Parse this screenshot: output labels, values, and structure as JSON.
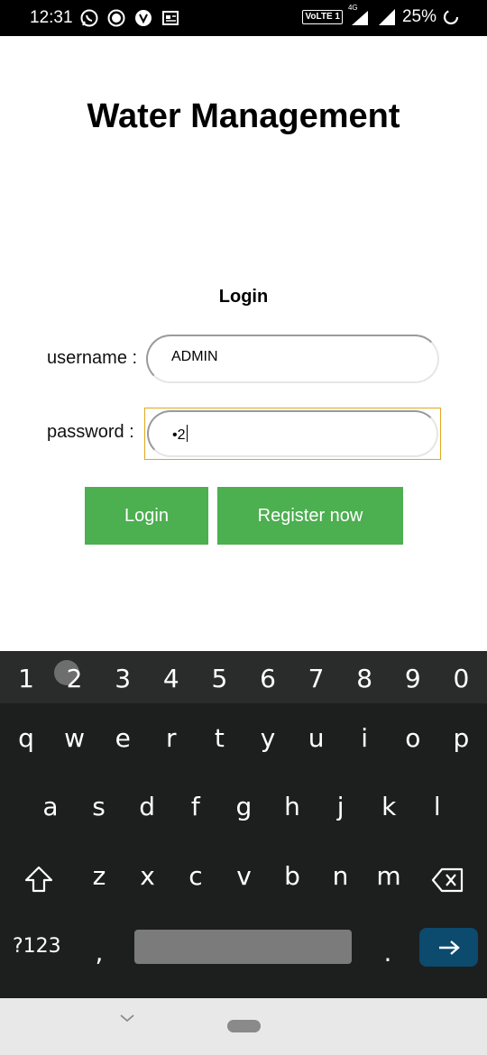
{
  "status_bar": {
    "time": "12:31",
    "volte": "VoLTE 1",
    "network": "4G",
    "battery": "25%",
    "icons": [
      "whatsapp-icon",
      "record-icon",
      "vpn-icon",
      "news-icon",
      "signal-icon",
      "battery-icon"
    ]
  },
  "app": {
    "title": "Water Management",
    "login_heading": "Login",
    "username_label": "username :",
    "username_value": "ADMIN",
    "password_label": "password :",
    "password_value": "•2",
    "login_button": "Login",
    "register_button": "Register now",
    "accent_color": "#4caf50",
    "focus_color": "#e0a820"
  },
  "keyboard": {
    "numbers": [
      "1",
      "2",
      "3",
      "4",
      "5",
      "6",
      "7",
      "8",
      "9",
      "0"
    ],
    "row1": [
      "q",
      "w",
      "e",
      "r",
      "t",
      "y",
      "u",
      "i",
      "o",
      "p"
    ],
    "row2": [
      "a",
      "s",
      "d",
      "f",
      "g",
      "h",
      "j",
      "k",
      "l"
    ],
    "row3": [
      "z",
      "x",
      "c",
      "v",
      "b",
      "n",
      "m"
    ],
    "symbols_label": "?123",
    "comma": ",",
    "period": ".",
    "enter_color": "#0c4a6e"
  }
}
